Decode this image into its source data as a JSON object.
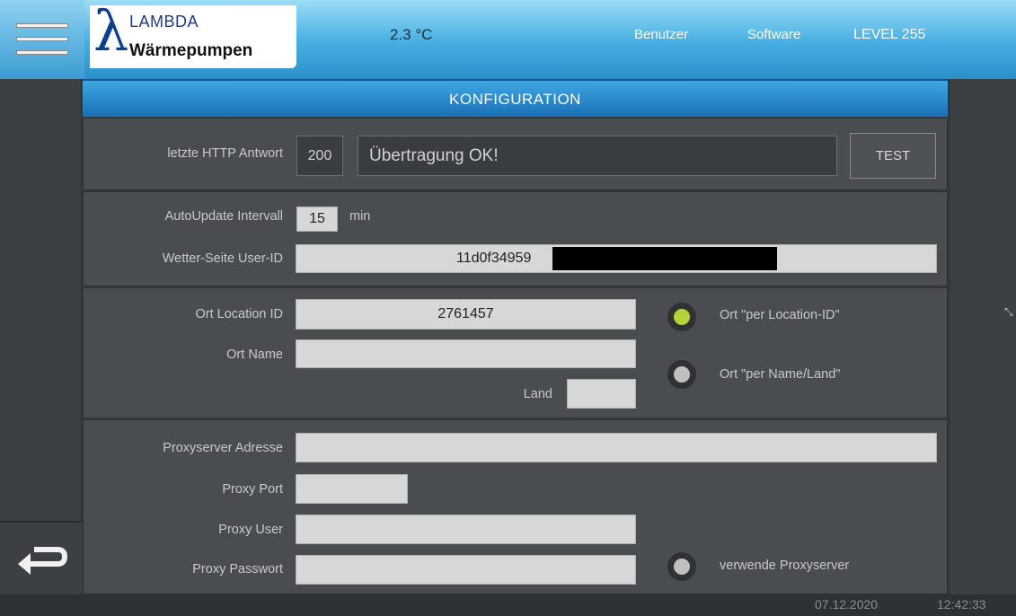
{
  "header": {
    "logo_top": "LAMBDA",
    "logo_bottom": "Wärmepumpen",
    "temperature": "2.3 °C",
    "user_label": "Benutzer",
    "software_label": "Software",
    "level_label": "LEVEL 255"
  },
  "page": {
    "title": "KONFIGURATION"
  },
  "http": {
    "label": "letzte HTTP Antwort",
    "code": "200",
    "message": "Übertragung OK!",
    "test_label": "TEST"
  },
  "update": {
    "interval_label": "AutoUpdate Intervall",
    "interval_value": "15",
    "interval_unit": "min",
    "userid_label": "Wetter-Seite User-ID",
    "userid_value": "11d0f34959"
  },
  "location": {
    "id_label": "Ort Location ID",
    "id_value": "2761457",
    "name_label": "Ort Name",
    "name_value": "",
    "land_label": "Land",
    "land_value": "",
    "option_location_id": "Ort \"per Location-ID\"",
    "option_name_land": "Ort \"per Name/Land\"",
    "selected": "location_id"
  },
  "proxy": {
    "address_label": "Proxyserver Adresse",
    "port_label": "Proxy Port",
    "user_label": "Proxy User",
    "password_label": "Proxy Passwort",
    "use_proxy_label": "verwende Proxyserver",
    "use_proxy": false
  },
  "status": {
    "date": "07.12.2020",
    "time": "12:42:33"
  },
  "colors": {
    "accent": "#2a8fd0",
    "radio_on": "#b4d23a",
    "radio_off": "#bfc1c1"
  }
}
